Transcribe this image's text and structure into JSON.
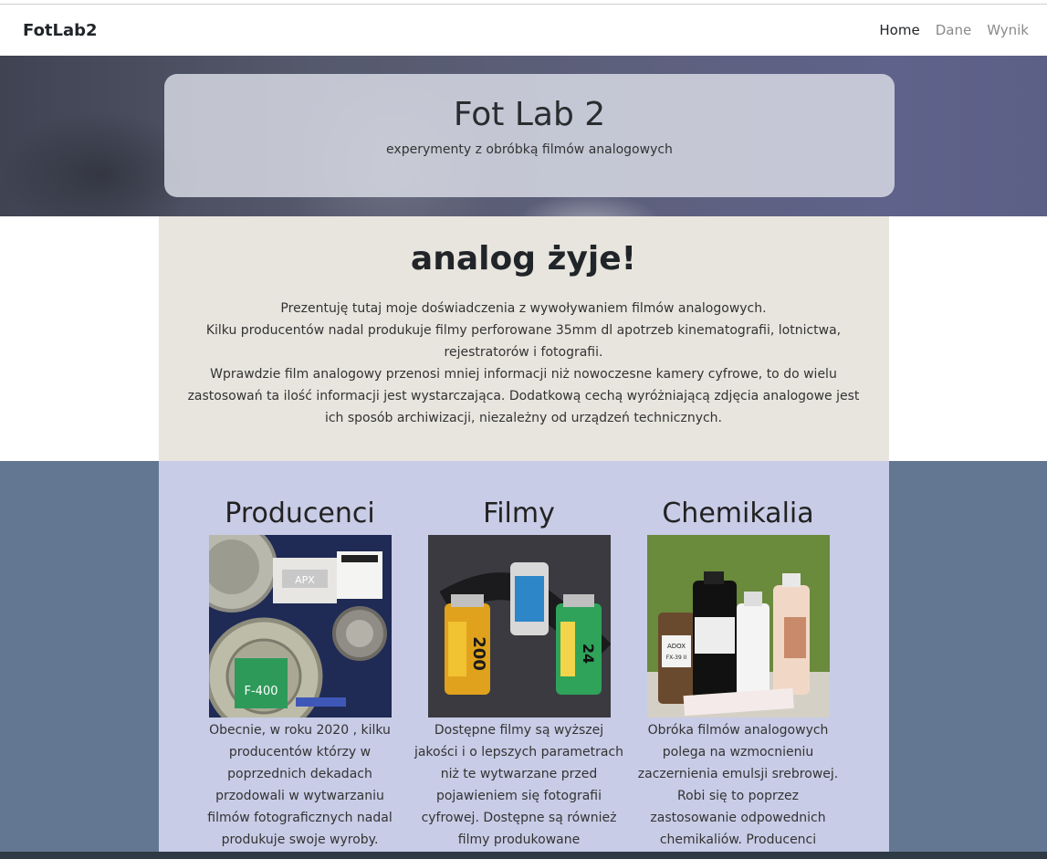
{
  "navbar": {
    "brand": "FotLab2",
    "links": [
      "Home",
      "Dane",
      "Wynik"
    ]
  },
  "hero": {
    "title": "Fot Lab 2",
    "subtitle": "experymenty z obróbką filmów analogowych"
  },
  "intro": {
    "heading": "analog żyje!",
    "lines": [
      "Prezentuję tutaj moje doświadczenia z wywoływaniem filmów analogowych.",
      "Kilku producentów nadal produkuje filmy perforowane 35mm dl apotrzeb kinematografii, lotnictwa, rejestratorów i fotografii.",
      "Wprawdzie film analogowy przenosi mniej informacji niż nowoczesne kamery cyfrowe, to do wielu zastosowań ta ilość informacji jest wystarczająca. Dodatkową cechą wyróżniającą zdjęcia analogowe jest ich sposób archiwizacji, niezależny od urządzeń technicznych."
    ]
  },
  "cards": [
    {
      "title": "Producenci",
      "text": "Obecnie, w roku 2020 , kilku producentów którzy w poprzednich dekadach przodowali w wytwarzaniu filmów fotograficznych nadal produkuje swoje wyroby."
    },
    {
      "title": "Filmy",
      "text": "Dostępne filmy są wyższej jakości i o lepszych parametrach niż te wytwarzane przed pojawieniem się fotografii cyfrowej. Dostępne są również filmy produkowane"
    },
    {
      "title": "Chemikalia",
      "text": "Obróka filmów analogowych polega na wzmocnieniu zaczernienia emulsji srebrowej. Robi się to poprzez zastosowanie odpowednich chemikaliów. Producenci"
    }
  ],
  "image_labels": {
    "producers": [
      "APX",
      "F-400"
    ],
    "films": [
      "200",
      "24"
    ],
    "chemicals": [
      "ADOX",
      "FX-39 II"
    ]
  }
}
